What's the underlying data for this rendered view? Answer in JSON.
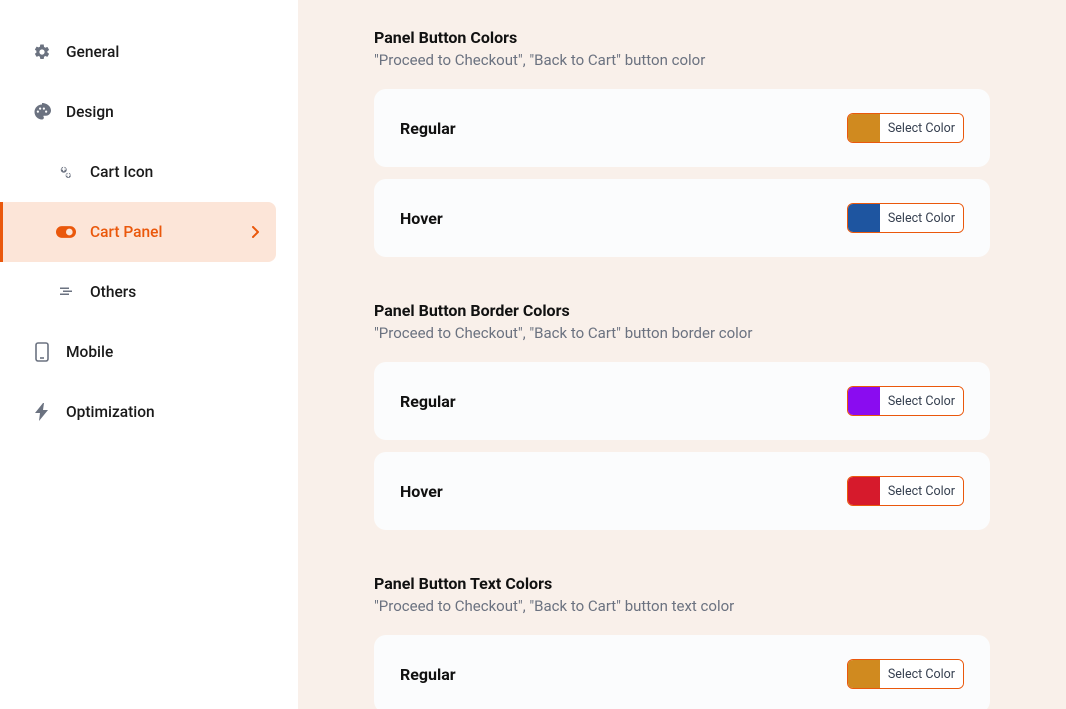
{
  "sidebar": {
    "items": [
      {
        "label": "General",
        "icon": "gear-icon",
        "interactable": true
      },
      {
        "label": "Design",
        "icon": "palette-icon",
        "interactable": true
      },
      {
        "label": "Cart Icon",
        "icon": "gears-icon",
        "interactable": true,
        "sub": true
      },
      {
        "label": "Cart Panel",
        "icon": "toggle-icon",
        "interactable": true,
        "sub": true,
        "active": true,
        "chevron": true
      },
      {
        "label": "Others",
        "icon": "stack-icon",
        "interactable": true,
        "sub": true
      },
      {
        "label": "Mobile",
        "icon": "mobile-icon",
        "interactable": true
      },
      {
        "label": "Optimization",
        "icon": "bolt-icon",
        "interactable": true
      }
    ]
  },
  "sections": [
    {
      "title": "Panel Button Colors",
      "desc": "\"Proceed to Checkout\", \"Back to Cart\" button color",
      "rows": [
        {
          "label": "Regular",
          "color": "#d08a1f",
          "button": "Select Color"
        },
        {
          "label": "Hover",
          "color": "#1e55a0",
          "button": "Select Color"
        }
      ]
    },
    {
      "title": "Panel Button Border Colors",
      "desc": "\"Proceed to Checkout\", \"Back to Cart\" button border color",
      "rows": [
        {
          "label": "Regular",
          "color": "#8a0cf0",
          "button": "Select Color"
        },
        {
          "label": "Hover",
          "color": "#d61a2c",
          "button": "Select Color"
        }
      ]
    },
    {
      "title": "Panel Button Text Colors",
      "desc": "\"Proceed to Checkout\", \"Back to Cart\" button text color",
      "rows": [
        {
          "label": "Regular",
          "color": "#d08a1f",
          "button": "Select Color"
        }
      ]
    }
  ]
}
